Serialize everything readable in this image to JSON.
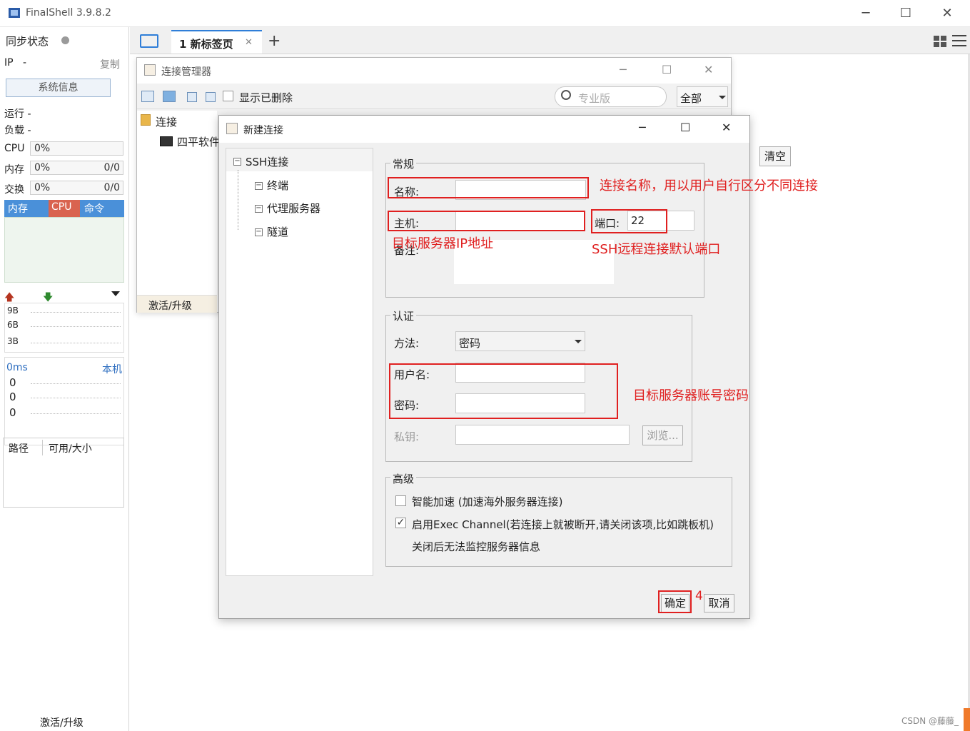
{
  "app": {
    "title": "FinalShell 3.9.8.2",
    "accent": "#2f7ed8"
  },
  "sidebar": {
    "sync_status_label": "同步状态",
    "ip_label": "IP",
    "ip_value": "-",
    "copy_label": "复制",
    "sysinfo_button": "系统信息",
    "run_label": "运行 -",
    "load_label": "负载 -",
    "cpu_label": "CPU",
    "cpu_value": "0%",
    "mem_label": "内存",
    "mem_value": "0%",
    "mem_extra": "0/0",
    "swap_label": "交换",
    "swap_value": "0%",
    "swap_extra": "0/0",
    "proc_tabs": [
      "内存",
      "CPU",
      "命令"
    ],
    "net_scale": [
      "9B",
      "6B",
      "3B"
    ],
    "ping_label": "0ms",
    "local_label": "本机",
    "ping_values": [
      "0",
      "0",
      "0"
    ],
    "disk_cols": [
      "路径",
      "可用/大小"
    ],
    "upgrade_label": "激活/升级"
  },
  "tabs": {
    "active_tab": "1 新标签页",
    "add_label": "+"
  },
  "conn_manager": {
    "title": "连接管理器",
    "show_deleted_label": "显示已删除",
    "search_placeholder": "专业版",
    "filter_value": "全部",
    "tree_root": "连接",
    "tree_item": "四平软件",
    "upgrade_label": "激活/升级",
    "clear_button": "清空"
  },
  "new_conn": {
    "title": "新建连接",
    "tree": {
      "root": "SSH连接",
      "items": [
        "终端",
        "代理服务器",
        "隧道"
      ]
    },
    "general": {
      "legend": "常规",
      "name_label": "名称:",
      "name_value": "",
      "host_label": "主机:",
      "host_value": "",
      "port_label": "端口:",
      "port_value": "22",
      "note_label": "备注:"
    },
    "auth": {
      "legend": "认证",
      "method_label": "方法:",
      "method_value": "密码",
      "user_label": "用户名:",
      "user_value": "",
      "pass_label": "密码:",
      "pass_value": "",
      "key_label": "私钥:",
      "browse_button": "浏览..."
    },
    "advanced": {
      "legend": "高级",
      "smart_accel_label": "智能加速 (加速海外服务器连接)",
      "smart_accel_checked": false,
      "exec_channel_label": "启用Exec Channel(若连接上就被断开,请关闭该项,比如跳板机)",
      "exec_channel_checked": true,
      "exec_channel_note": "关闭后无法监控服务器信息"
    },
    "ok_button": "确定",
    "cancel_button": "取消"
  },
  "annotations": {
    "name_note": "连接名称，用以用户自行区分不同连接",
    "host_note": "目标服务器IP地址",
    "port_note": "SSH远程连接默认端口",
    "account_note": "目标服务器账号密码",
    "step_number": "4",
    "color": "#e02020"
  },
  "watermark": "CSDN @藤藤_"
}
